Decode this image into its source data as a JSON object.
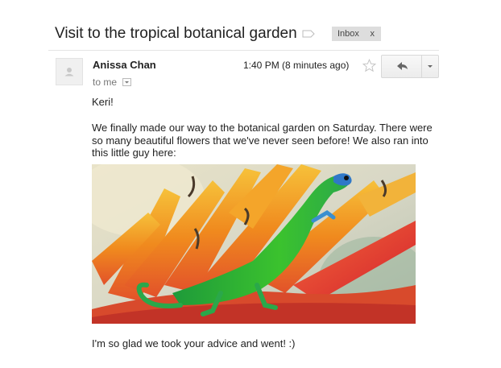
{
  "email": {
    "subject": "Visit to the tropical botanical garden",
    "label_chip": "Inbox",
    "label_remove": "x",
    "sender_name": "Anissa Chan",
    "recipient": "to me",
    "time": "1:40 PM (8 minutes ago)",
    "greeting": "Keri!",
    "paragraph": "We finally made our way to the botanical garden on Saturday. There were so many beautiful flowers that we've never seen before! We also ran into this little guy here:",
    "closing": "I'm so glad we took your advice and went! :)"
  },
  "icons": {
    "label": "label-tag-icon",
    "avatar": "person-icon",
    "star": "star-icon",
    "reply": "reply-arrow-icon",
    "more": "chevron-down-icon"
  },
  "colors": {
    "chip_bg": "#dddddd",
    "gecko_green": "#2fb02a",
    "flower_orange": "#f08a1e",
    "flower_red": "#e23a2a"
  }
}
